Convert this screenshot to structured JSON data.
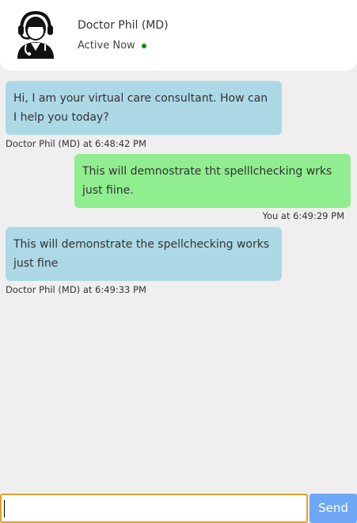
{
  "header": {
    "name": "Doctor Phil (MD)",
    "status": "Active Now",
    "status_color": "#138a13",
    "avatar_icon": "doctor-headset-icon"
  },
  "messages": [
    {
      "sender": "bot",
      "text": "Hi, I am your virtual care consultant. How can I help you today?",
      "meta": "Doctor Phil (MD) at 6:48:42 PM"
    },
    {
      "sender": "user",
      "text": "This will demnostrate tht spelllchecking wrks just fiine.",
      "meta": "You at 6:49:29 PM"
    },
    {
      "sender": "bot",
      "text": "This will demonstrate the spellchecking works just fine",
      "meta": "Doctor Phil (MD) at 6:49:33 PM"
    }
  ],
  "composer": {
    "value": "",
    "send_label": "Send"
  },
  "colors": {
    "bot_bubble": "#add8e6",
    "user_bubble": "#90ee90",
    "background": "#efefef",
    "send_button": "#6ea8f5",
    "input_border": "#e3a02c"
  }
}
